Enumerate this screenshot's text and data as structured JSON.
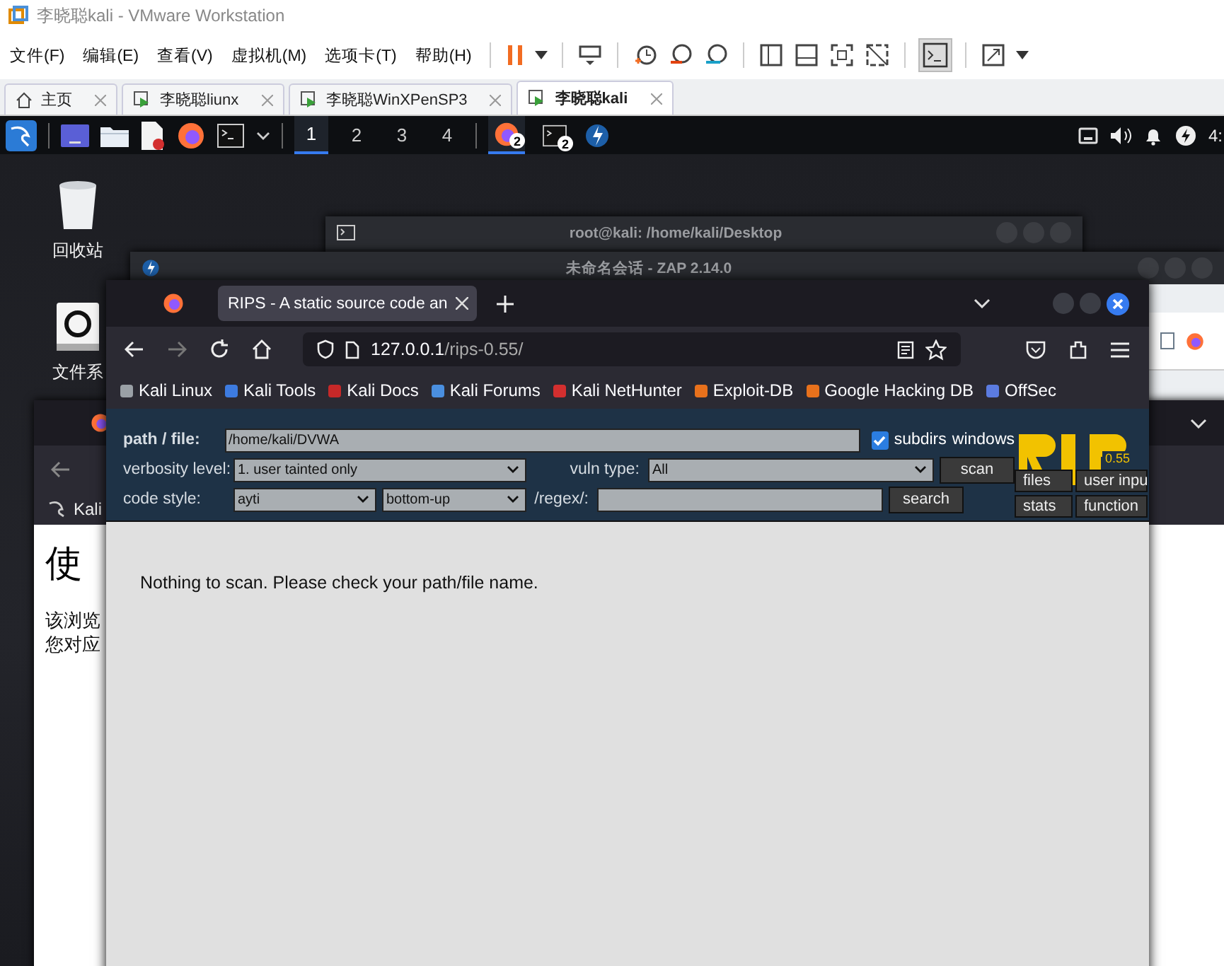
{
  "window": {
    "title": "李晓聪kali - VMware Workstation"
  },
  "menu": [
    "文件(F)",
    "编辑(E)",
    "查看(V)",
    "虚拟机(M)",
    "选项卡(T)",
    "帮助(H)"
  ],
  "vm_tabs": [
    {
      "label": "主页",
      "kind": "home",
      "selected": false
    },
    {
      "label": "李晓聪liunx",
      "kind": "vm",
      "selected": false
    },
    {
      "label": "李晓聪WinXPenSP3",
      "kind": "vm",
      "selected": false
    },
    {
      "label": "李晓聪kali",
      "kind": "vm",
      "selected": true
    }
  ],
  "panel": {
    "workspaces": [
      {
        "label": "1",
        "selected": true
      },
      {
        "label": "2",
        "selected": false
      },
      {
        "label": "3",
        "selected": false
      },
      {
        "label": "4",
        "selected": false
      }
    ],
    "badges": [
      "2",
      "2"
    ],
    "clock": "4:"
  },
  "desktop_icons": [
    {
      "label": "回收站",
      "kind": "trash"
    },
    {
      "label": "文件系",
      "kind": "drive"
    }
  ],
  "back_windows": [
    {
      "title": "root@kali: /home/kali/Desktop",
      "kind": "terminal"
    },
    {
      "title": "未命名会话 - ZAP 2.14.0",
      "kind": "zap"
    }
  ],
  "back_browser": {
    "bookmark": "Kali",
    "heading": "使",
    "lines": [
      "该浏览",
      "您对应"
    ]
  },
  "browser": {
    "tab": "RIPS - A static source code an",
    "url_host": "127.0.0.1",
    "url_path": "/rips-0.55/",
    "bookmarks": [
      {
        "label": "Kali Linux",
        "color": "#9aa0a6"
      },
      {
        "label": "Kali Tools",
        "color": "#3d7be0"
      },
      {
        "label": "Kali Docs",
        "color": "#c62828"
      },
      {
        "label": "Kali Forums",
        "color": "#4a8fe0"
      },
      {
        "label": "Kali NetHunter",
        "color": "#d32f2f"
      },
      {
        "label": "Exploit-DB",
        "color": "#e8711c"
      },
      {
        "label": "Google Hacking DB",
        "color": "#e8711c"
      },
      {
        "label": "OffSec",
        "color": "#5b7be0"
      }
    ]
  },
  "rips": {
    "path_label": "path / file:",
    "path_value": "/home/kali/DVWA",
    "subdirs": {
      "label": "subdirs",
      "checked": true
    },
    "windows_label": "windows",
    "verbosity_label": "verbosity level:",
    "verbosity": "1. user tainted only",
    "vuln_label": "vuln type:",
    "vuln": "All",
    "code_label": "code style:",
    "code_style": "ayti",
    "order": "bottom-up",
    "regex_label": "/regex/:",
    "buttons": [
      "scan",
      "search"
    ],
    "side_buttons": [
      "files",
      "user inpu",
      "stats",
      "function"
    ],
    "version": "0.55"
  },
  "message": "Nothing to scan. Please check your path/file name."
}
